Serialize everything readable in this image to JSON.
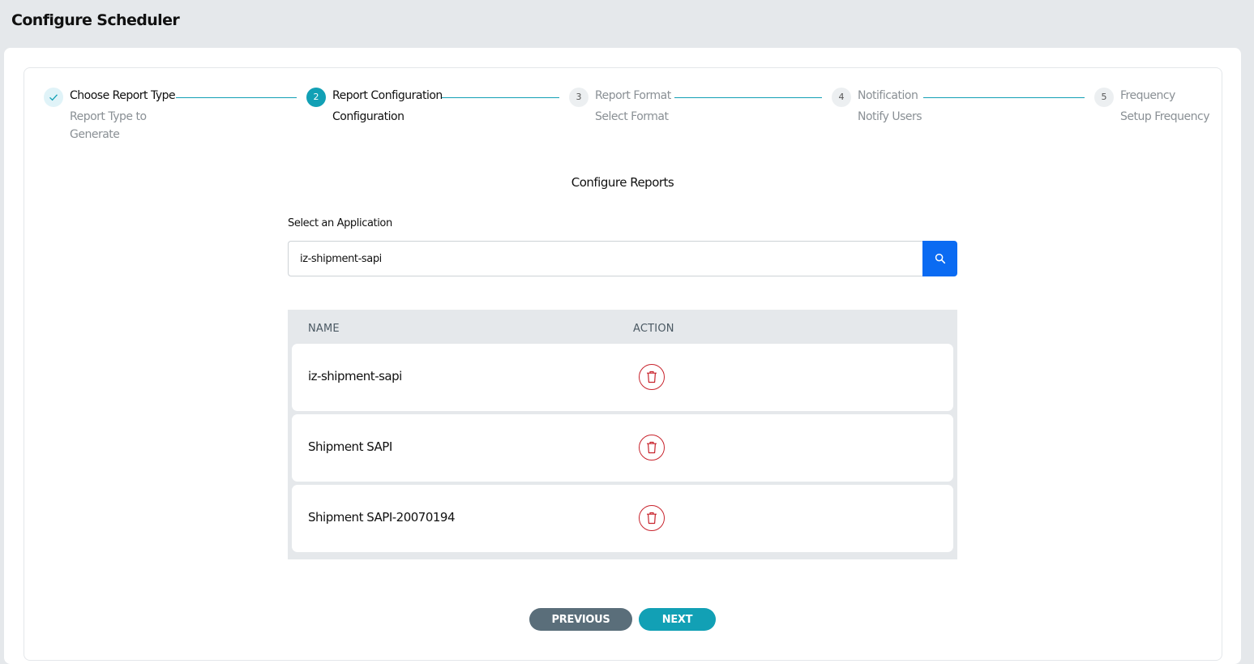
{
  "header": {
    "title": "Configure Scheduler"
  },
  "stepper": {
    "steps": [
      {
        "number": "",
        "title": "Choose Report Type",
        "subtitle": "Report Type to Generate",
        "state": "done"
      },
      {
        "number": "2",
        "title": "Report Configuration",
        "subtitle": "Configuration",
        "state": "active"
      },
      {
        "number": "3",
        "title": "Report Format",
        "subtitle": "Select Format",
        "state": "pending"
      },
      {
        "number": "4",
        "title": "Notification",
        "subtitle": "Notify Users",
        "state": "pending"
      },
      {
        "number": "5",
        "title": "Frequency",
        "subtitle": "Setup Frequency",
        "state": "pending"
      }
    ]
  },
  "main": {
    "section_title": "Configure Reports",
    "field_label": "Select an Application",
    "search": {
      "value": "iz-shipment-sapi",
      "icon": "search-icon"
    },
    "table": {
      "columns": [
        "NAME",
        "ACTION"
      ],
      "rows": [
        {
          "name": "iz-shipment-sapi",
          "action_icon": "trash-icon"
        },
        {
          "name": "Shipment SAPI",
          "action_icon": "trash-icon"
        },
        {
          "name": "Shipment SAPI-20070194",
          "action_icon": "trash-icon"
        }
      ]
    }
  },
  "footer": {
    "previous_label": "PREVIOUS",
    "next_label": "NEXT"
  },
  "colors": {
    "accent": "#12a0b5",
    "primary_button": "#0b6bf2",
    "danger": "#c8232c",
    "secondary_button": "#5a6e7a",
    "background": "#e5e8eb"
  }
}
